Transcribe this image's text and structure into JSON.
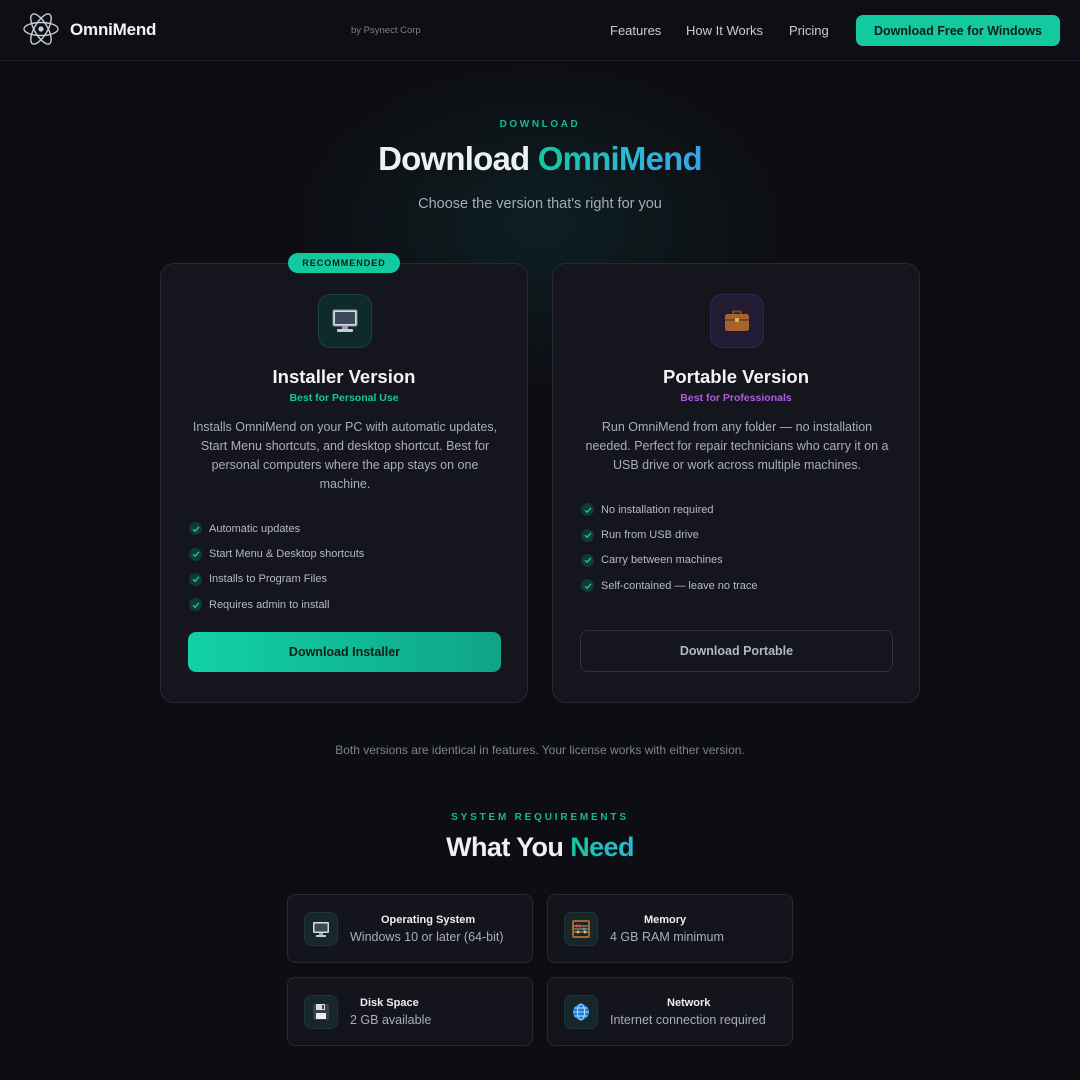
{
  "header": {
    "brand": "OmniMend",
    "byline": "by Psynect Corp",
    "nav": [
      "Features",
      "How It Works",
      "Pricing"
    ],
    "cta_label": "Download Free for Windows"
  },
  "hero": {
    "eyebrow": "DOWNLOAD",
    "title_plain": "Download ",
    "title_accent": "OmniMend",
    "subtitle": "Choose the version that's right for you"
  },
  "cards": [
    {
      "badge": "RECOMMENDED",
      "icon": "desktop-computer-icon",
      "title": "Installer Version",
      "tagline": "Best for Personal Use",
      "description": "Installs OmniMend on your PC with automatic updates, Start Menu shortcuts, and desktop shortcut. Best for personal computers where the app stays on one machine.",
      "features": [
        "Automatic updates",
        "Start Menu & Desktop shortcuts",
        "Installs to Program Files",
        "Requires admin to install"
      ],
      "button": "Download Installer"
    },
    {
      "icon": "briefcase-icon",
      "title": "Portable Version",
      "tagline": "Best for Professionals",
      "description": "Run OmniMend from any folder — no installation needed. Perfect for repair technicians who carry it on a USB drive or work across multiple machines.",
      "features": [
        "No installation required",
        "Run from USB drive",
        "Carry between machines",
        "Self-contained — leave no trace"
      ],
      "button": "Download Portable"
    }
  ],
  "note": "Both versions are identical in features. Your license works with either version.",
  "requirements": {
    "eyebrow": "SYSTEM REQUIREMENTS",
    "title_plain": "What You ",
    "title_accent": "Need",
    "items": [
      {
        "icon": "desktop-computer-icon",
        "label": "Operating System",
        "value": "Windows 10 or later (64-bit)"
      },
      {
        "icon": "abacus-icon",
        "label": "Memory",
        "value": "4 GB RAM minimum"
      },
      {
        "icon": "floppy-disk-icon",
        "label": "Disk Space",
        "value": "2 GB available"
      },
      {
        "icon": "globe-icon",
        "label": "Network",
        "value": "Internet connection required"
      }
    ]
  },
  "colors": {
    "background": "#0d0e14",
    "accent": "#12c9a0",
    "purple_accent": "#b05ee0",
    "card": "#14151d"
  }
}
